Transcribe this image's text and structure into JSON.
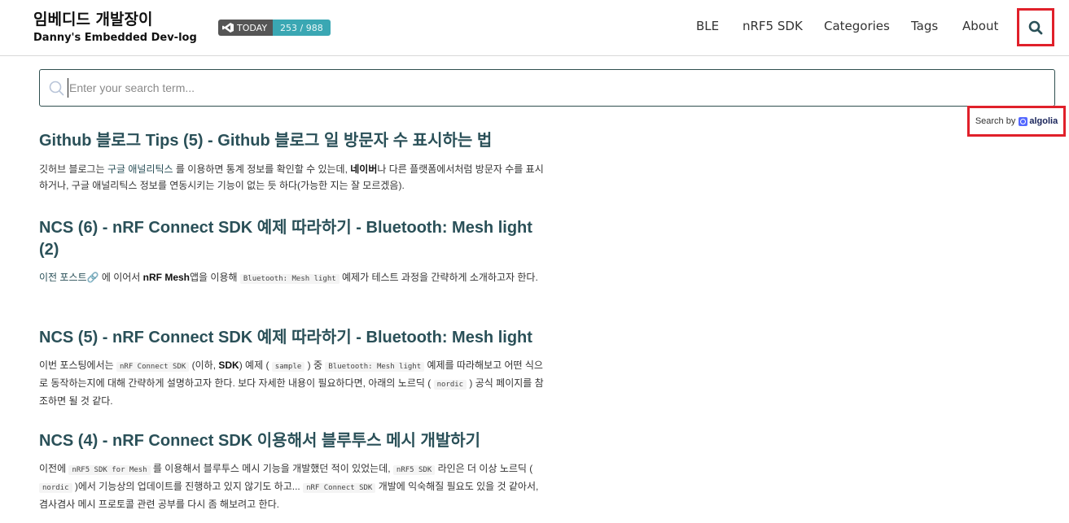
{
  "site": {
    "title": "임베디드 개발장이",
    "subtitle": "Danny's Embedded Dev-log"
  },
  "badge": {
    "label": "TODAY",
    "count": "253 / 988",
    "icon": "vscode-icon"
  },
  "nav": {
    "items": [
      {
        "label": "BLE"
      },
      {
        "label": "nRF5 SDK"
      },
      {
        "label": "Categories"
      },
      {
        "label": "Tags"
      },
      {
        "label": "About"
      }
    ],
    "search_icon": "search-icon"
  },
  "search": {
    "placeholder": "Enter your search term...",
    "value": "",
    "search_by_label": "Search by",
    "provider": "algolia"
  },
  "results": [
    {
      "title": "Github 블로그 Tips (5) - Github 블로그 일 방문자 수 표시하는 법",
      "excerpt": {
        "p1": "깃허브 블로그는 ",
        "h1": "구글 애널리틱스",
        "p2": " 를 이용하면 통계 정보를 확인할 수 있는데, ",
        "b1": "네이버",
        "p3": "나 다른 플랫폼에서처럼 방문자 수를 표시하거나, 구글 애널리틱스 정보를 연동시키는 기능이 없는 듯 하다(가능한 지는 잘 모르겠음)."
      }
    },
    {
      "title": "NCS (6) - nRF Connect SDK 예제 따라하기 - Bluetooth: Mesh light (2)",
      "excerpt": {
        "h1": "이전 포스트🔗",
        "p1": " 에 이어서 ",
        "b1": "nRF Mesh",
        "p2": "앱을 이용해 ",
        "c1": "Bluetooth: Mesh light",
        "p3": " 예제가 테스트 과정을 간략하게 소개하고자 한다."
      }
    },
    {
      "title": "NCS (5) - nRF Connect SDK 예제 따라하기 - Bluetooth: Mesh light",
      "excerpt": {
        "p1": "이번 포스팅에서는 ",
        "c1": "nRF Connect SDK",
        "p2": " (이하, ",
        "b1": "SDK",
        "p3": ") 예제 ( ",
        "c2": "sample",
        "p4": " ) 중 ",
        "c3": "Bluetooth: Mesh light",
        "p5": " 예제를 따라해보고 어떤 식으로 동작하는지에 대해 간략하게 설명하고자 한다. 보다 자세한 내용이 필요하다면, 아래의 노르딕 ( ",
        "c4": "nordic",
        "p6": " ) 공식 페이지를 참조하면 될 것 같다."
      }
    },
    {
      "title": "NCS (4) - nRF Connect SDK 이용해서 블루투스 메시 개발하기",
      "excerpt": {
        "p1": "이전에 ",
        "c1": "nRF5 SDK for Mesh",
        "p2": " 를 이용해서 블루투스 메시 기능을 개발했던 적이 있었는데, ",
        "c2": "nRF5 SDK",
        "p3": " 라인은 더 이상 노르딕 ( ",
        "c3": "nordic",
        "p4": " )에서 기능상의 업데이트를 진행하고 있지 않기도 하고... ",
        "c4": "nRF Connect SDK",
        "p5": " 개발에 익숙해질 필요도 있을 것 같아서, 겸사겸사 메시 프로토콜 관련 공부를 다시 좀 해보려고 한다."
      }
    }
  ]
}
